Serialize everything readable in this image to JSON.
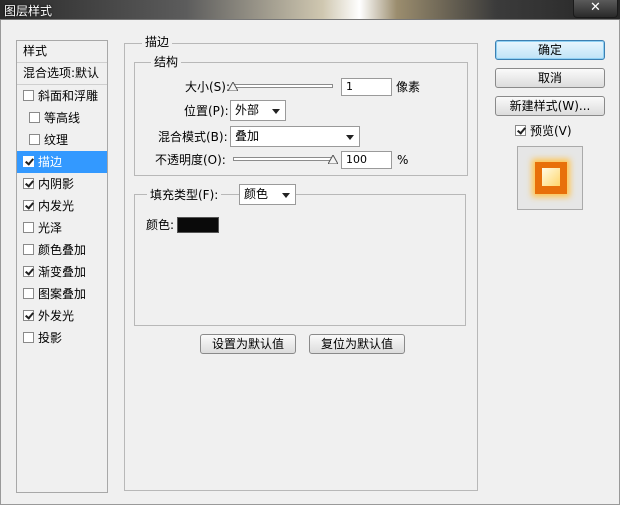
{
  "window": {
    "title": "图层样式"
  },
  "left_panel": {
    "header": "样式",
    "blend_options": "混合选项:默认",
    "items": [
      {
        "label": "斜面和浮雕",
        "checked": false,
        "sub": false,
        "active": false
      },
      {
        "label": "等高线",
        "checked": false,
        "sub": true,
        "active": false
      },
      {
        "label": "纹理",
        "checked": false,
        "sub": true,
        "active": false
      },
      {
        "label": "描边",
        "checked": true,
        "sub": false,
        "active": true
      },
      {
        "label": "内阴影",
        "checked": true,
        "sub": false,
        "active": false
      },
      {
        "label": "内发光",
        "checked": true,
        "sub": false,
        "active": false
      },
      {
        "label": "光泽",
        "checked": false,
        "sub": false,
        "active": false
      },
      {
        "label": "颜色叠加",
        "checked": false,
        "sub": false,
        "active": false
      },
      {
        "label": "渐变叠加",
        "checked": true,
        "sub": false,
        "active": false
      },
      {
        "label": "图案叠加",
        "checked": false,
        "sub": false,
        "active": false
      },
      {
        "label": "外发光",
        "checked": true,
        "sub": false,
        "active": false
      },
      {
        "label": "投影",
        "checked": false,
        "sub": false,
        "active": false
      }
    ]
  },
  "stroke": {
    "section_title": "描边",
    "structure_title": "结构",
    "size_label": "大小(S):",
    "size_value": "1",
    "size_unit": "像素",
    "size_fraction": 0.0,
    "position_label": "位置(P):",
    "position_value": "外部",
    "blend_mode_label": "混合模式(B):",
    "blend_mode_value": "叠加",
    "opacity_label": "不透明度(O):",
    "opacity_value": "100",
    "opacity_unit": "%",
    "opacity_fraction": 1.0,
    "fill_type_label": "填充类型(F):",
    "fill_type_value": "颜色",
    "color_label": "颜色:",
    "color_hex": "#0a0a0a",
    "make_default_label": "设置为默认值",
    "reset_default_label": "复位为默认值"
  },
  "actions": {
    "ok_label": "确定",
    "cancel_label": "取消",
    "new_style_label": "新建样式(W)...",
    "preview_label": "预览(V)",
    "preview_checked": true
  }
}
